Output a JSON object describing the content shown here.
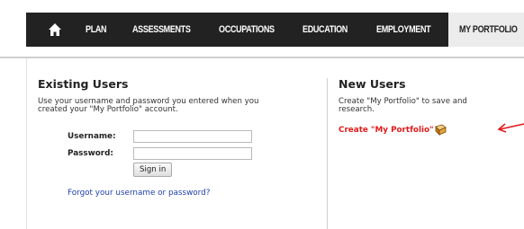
{
  "nav": {
    "home_icon": "home-icon",
    "items": [
      {
        "label": "PLAN"
      },
      {
        "label": "ASSESSMENTS"
      },
      {
        "label": "OCCUPATIONS"
      },
      {
        "label": "EDUCATION"
      },
      {
        "label": "EMPLOYMENT"
      },
      {
        "label": "MY PORTFOLIO",
        "active": true
      }
    ]
  },
  "existing": {
    "heading": "Existing Users",
    "intro_line1": "Use your username and password you entered when you",
    "intro_line2": "created your \"My Portfolio\" account.",
    "username_label": "Username:",
    "username_value": "",
    "password_label": "Password:",
    "password_value": "",
    "signin_label": "Sign in",
    "forgot_label": "Forgot your username or password?"
  },
  "new_users": {
    "heading": "New Users",
    "intro_line1": "Create \"My Portfolio\" to save and",
    "intro_line2": "research.",
    "create_label": "Create \"My Portfolio\"",
    "create_icon": "book-icon"
  },
  "colors": {
    "nav_bg": "#222222",
    "link": "#1f3fa8",
    "red_link": "#e01a1a",
    "arrow": "#e01a1a"
  }
}
